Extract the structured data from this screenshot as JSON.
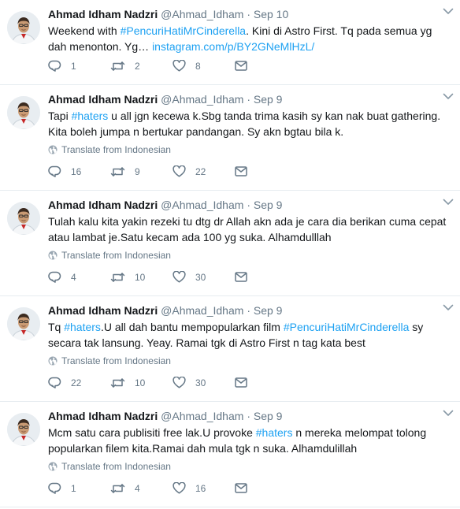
{
  "tweets": [
    {
      "name": "Ahmad Idham Nadzri",
      "handle": "@Ahmad_Idham",
      "sep": "·",
      "date": "Sep 10",
      "parts": [
        {
          "t": "Weekend with "
        },
        {
          "t": "#PencuriHatiMrCinderella",
          "tag": true
        },
        {
          "t": ". Kini di Astro First. Tq pada semua yg dah menonton. Yg… "
        },
        {
          "t": "instagram.com/p/BY2GNeMlHzL/",
          "tag": true
        }
      ],
      "translate": "",
      "replies": "1",
      "retweets": "2",
      "likes": "8"
    },
    {
      "name": "Ahmad Idham Nadzri",
      "handle": "@Ahmad_Idham",
      "sep": "·",
      "date": "Sep 9",
      "parts": [
        {
          "t": "Tapi "
        },
        {
          "t": "#haters",
          "tag": true
        },
        {
          "t": " u all jgn kecewa k.Sbg tanda trima kasih sy kan nak buat gathering. Kita boleh jumpa n bertukar pandangan. Sy akn bgtau bila k."
        }
      ],
      "translate": "Translate from Indonesian",
      "replies": "16",
      "retweets": "9",
      "likes": "22"
    },
    {
      "name": "Ahmad Idham Nadzri",
      "handle": "@Ahmad_Idham",
      "sep": "·",
      "date": "Sep 9",
      "parts": [
        {
          "t": "Tulah kalu kita yakin rezeki tu dtg dr Allah akn ada je cara dia berikan cuma cepat atau lambat je.Satu kecam ada 100 yg suka. Alhamdulllah"
        }
      ],
      "translate": "Translate from Indonesian",
      "replies": "4",
      "retweets": "10",
      "likes": "30"
    },
    {
      "name": "Ahmad Idham Nadzri",
      "handle": "@Ahmad_Idham",
      "sep": "·",
      "date": "Sep 9",
      "parts": [
        {
          "t": "Tq "
        },
        {
          "t": "#haters",
          "tag": true
        },
        {
          "t": ".U all dah bantu mempopularkan film "
        },
        {
          "t": "#PencuriHatiMrCinderella",
          "tag": true
        },
        {
          "t": " sy secara tak lansung. Yeay. Ramai tgk di Astro First n tag kata best"
        }
      ],
      "translate": "Translate from Indonesian",
      "replies": "22",
      "retweets": "10",
      "likes": "30"
    },
    {
      "name": "Ahmad Idham Nadzri",
      "handle": "@Ahmad_Idham",
      "sep": "·",
      "date": "Sep 9",
      "parts": [
        {
          "t": "Mcm satu cara publisiti free lak.U provoke "
        },
        {
          "t": "#haters",
          "tag": true
        },
        {
          "t": " n mereka melompat tolong popularkan filem kita.Ramai dah mula tgk n suka. Alhamdulillah"
        }
      ],
      "translate": "Translate from Indonesian",
      "replies": "1",
      "retweets": "4",
      "likes": "16"
    }
  ],
  "icons": {
    "reply": "reply-icon",
    "retweet": "retweet-icon",
    "like": "heart-icon",
    "dm": "envelope-icon",
    "caret": "chevron-down-icon",
    "globe": "globe-icon"
  },
  "colors": {
    "link": "#1da1f2",
    "meta": "#657786",
    "text": "#14171a",
    "divider": "#e6ecf0"
  }
}
